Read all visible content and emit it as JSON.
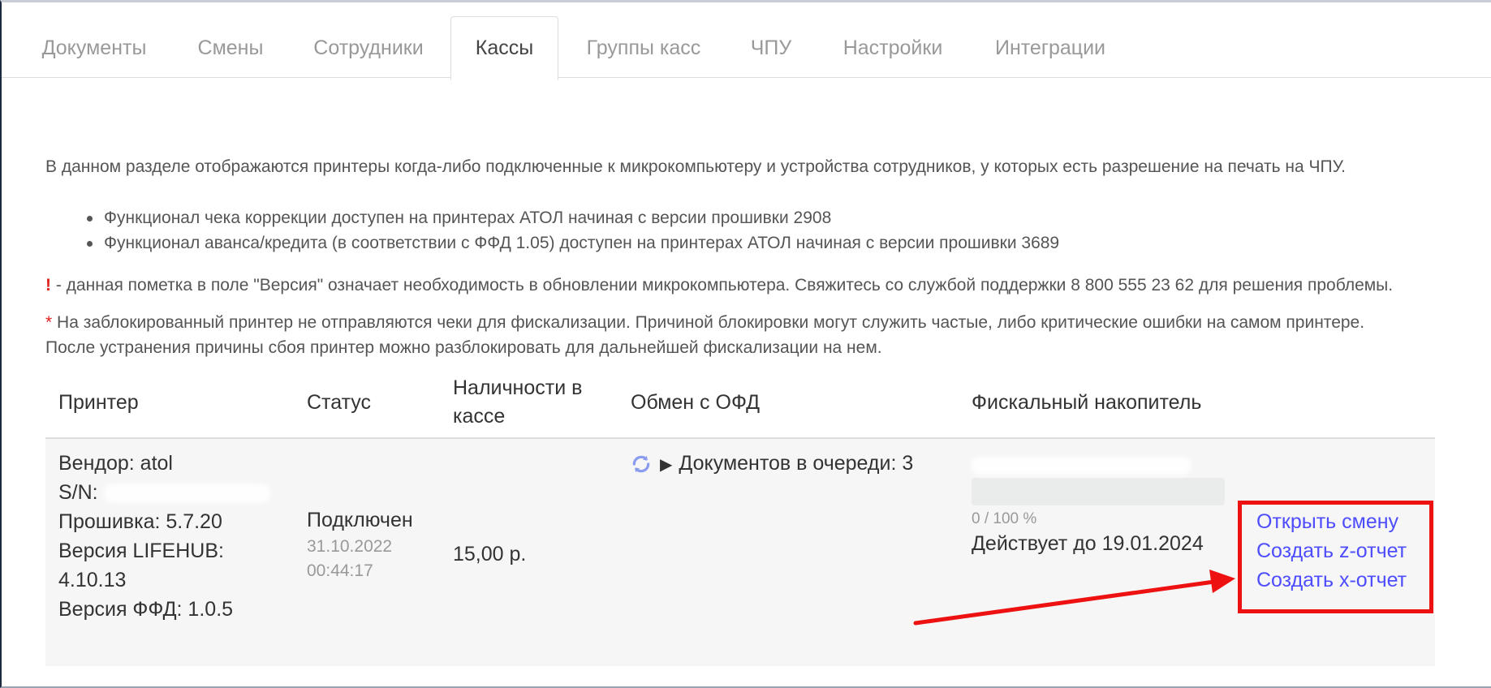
{
  "tabs": [
    {
      "label": "Документы"
    },
    {
      "label": "Смены"
    },
    {
      "label": "Сотрудники"
    },
    {
      "label": "Кассы",
      "active": true
    },
    {
      "label": "Группы касс"
    },
    {
      "label": "ЧПУ"
    },
    {
      "label": "Настройки"
    },
    {
      "label": "Интеграции"
    }
  ],
  "intro": "В данном разделе отображаются принтеры когда-либо подключенные к микрокомпьютеру и устройства сотрудников, у которых есть разрешение на печать на ЧПУ.",
  "bullets": [
    "Функционал чека коррекции доступен на принтерах АТОЛ начиная с версии прошивки 2908",
    "Функционал аванса/кредита (в соответствии с ФФД 1.05) доступен на принтерах АТОЛ начиная с версии прошивки 3689"
  ],
  "warning": {
    "mark": "!",
    "text": " - данная пометка в поле \"Версия\" означает необходимость в обновлении микрокомпьютера. Свяжитесь со службой поддержки 8 800 555 23 62 для решения проблемы."
  },
  "blocked_note": {
    "mark": "*",
    "line1": " На заблокированный принтер не отправляются чеки для фискализации. Причиной блокировки могут служить частые, либо критические ошибки на самом принтере.",
    "line2": "После устранения причины сбоя принтер можно разблокировать для дальнейшей фискализации на нем."
  },
  "table": {
    "headers": {
      "printer": "Принтер",
      "status": "Статус",
      "cash_line1": "Наличности в",
      "cash_line2": "кассе",
      "ofd": "Обмен с ОФД",
      "fn": "Фискальный накопитель"
    },
    "row": {
      "vendor": "Вендор: atol",
      "sn_label": "S/N:",
      "firmware": "Прошивка: 5.7.20",
      "lifehub_label": "Версия LIFEHUB:",
      "lifehub_value": "4.10.13",
      "ffd": "Версия ФФД: 1.0.5",
      "status": "Подключен",
      "status_date": "31.10.2022",
      "status_time": "00:44:17",
      "cash": "15,00 р.",
      "ofd_queue": "Документов в очереди: 3",
      "fn_progress_text": "0 / 100 %",
      "fn_progress_value": 0,
      "fn_valid_until": "Действует до 19.01.2024",
      "actions": {
        "open_shift": "Открыть смену",
        "z_report": "Создать z-отчет",
        "x_report": "Создать x-отчет"
      }
    }
  },
  "colors": {
    "link": "#4d4dff",
    "annotation_red": "#ee1111",
    "row_bg": "#f6f6f6"
  }
}
